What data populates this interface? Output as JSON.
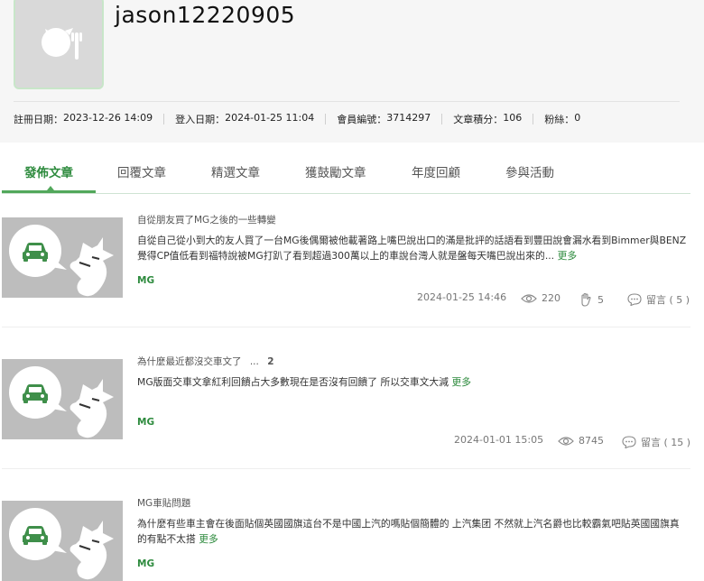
{
  "profile": {
    "username": "jason12220905",
    "stats": [
      {
        "label": "註冊日期：",
        "value": "2023-12-26 14:09"
      },
      {
        "label": "登入日期：",
        "value": "2024-01-25 11:04"
      },
      {
        "label": "會員編號：",
        "value": "3714297"
      },
      {
        "label": "文章積分：",
        "value": "106"
      },
      {
        "label": "粉絲：",
        "value": "0"
      }
    ]
  },
  "tabs": [
    "發佈文章",
    "回覆文章",
    "精選文章",
    "獲鼓勵文章",
    "年度回顧",
    "參與活動"
  ],
  "posts": [
    {
      "title": "自從朋友買了MG之後的一些轉變",
      "body": "自從自己從小到大的友人買了一台MG後偶爾被他載著路上嘴巴說出口的滿是批評的話語看到豐田說會漏水看到Bimmer與BENZ 覺得CP值低看到福特說被MG打趴了看到超過300萬以上的車說台灣人就是盤每天嘴巴說出來的...",
      "more": "更多",
      "tag": "MG",
      "date": "2024-01-25 14:46",
      "views": "220",
      "likes": "5",
      "comments_label": "留言",
      "comments": "( 5 )"
    },
    {
      "title": "為什麼最近都沒交車文了",
      "ellipsis": "...",
      "page_count": "2",
      "body": "MG版面交車文拿紅利回饋占大多數現在是否沒有回饋了 所以交車文大減",
      "more": "更多",
      "tag": "MG",
      "date": "2024-01-01 15:05",
      "views": "8745",
      "comments_label": "留言",
      "comments": "( 15 )"
    },
    {
      "title": "MG車貼問題",
      "body": "為什麼有些車主會在後面貼個英國國旗這台不是中國上汽的嗎貼個簡體的 上汽集团 不然就上汽名爵也比較霸氣吧貼英國國旗真的有點不太搭",
      "more": "更多",
      "tag": "MG"
    }
  ],
  "colors": {
    "accent": "#2e8b3e",
    "tab_underline": "#52a85b",
    "thumb_bg": "#bdbdbd"
  }
}
